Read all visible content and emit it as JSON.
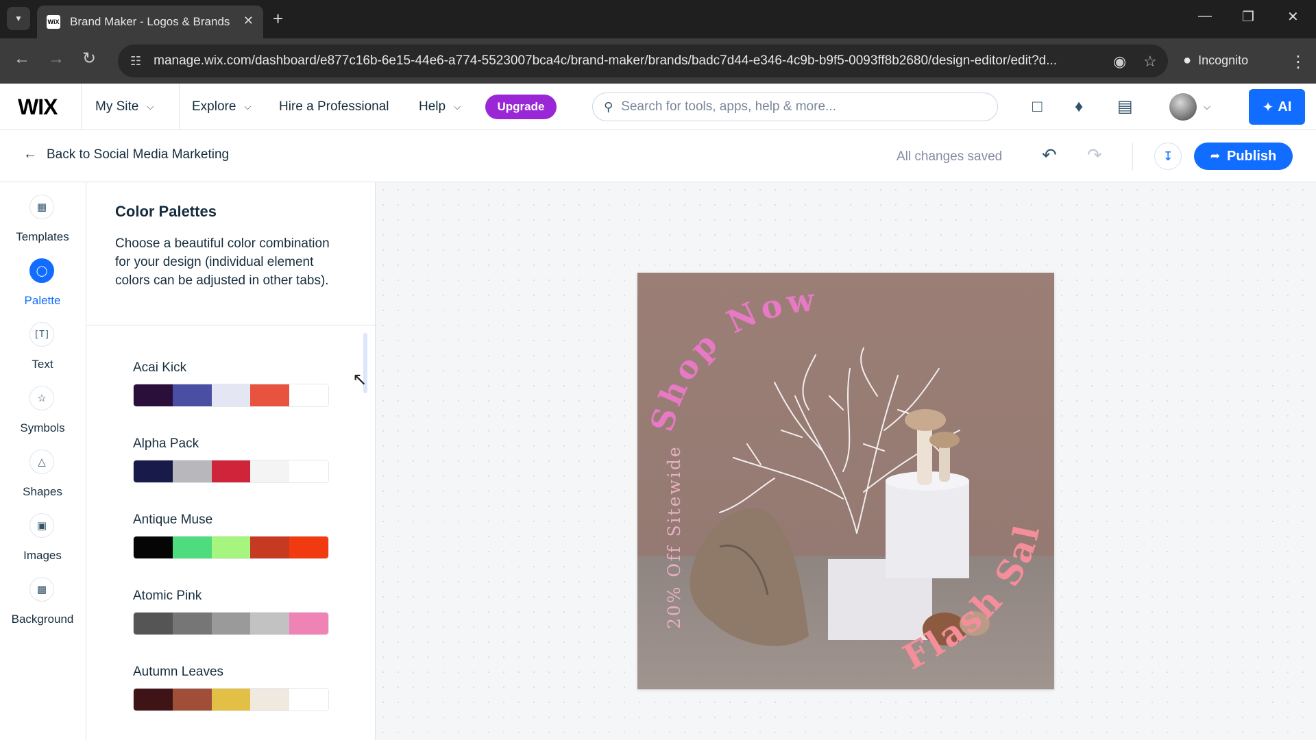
{
  "browser": {
    "tab_title": "Brand Maker - Logos & Brands",
    "favicon_text": "WiX",
    "url": "manage.wix.com/dashboard/e877c16b-6e15-44e6-a774-5523007bca4c/brand-maker/brands/badc7d44-e346-4c9b-b9f5-0093ff8b2680/design-editor/edit?d...",
    "incognito_label": "Incognito"
  },
  "wix_bar": {
    "logo": "WIX",
    "site_menu": "My Site",
    "nav": [
      "Explore",
      "Hire a Professional",
      "Help"
    ],
    "upgrade_label": "Upgrade",
    "search_placeholder": "Search for tools, apps, help & more...",
    "ai_label": "AI"
  },
  "editor_header": {
    "back_label": "Back to Social Media Marketing",
    "status": "All changes saved",
    "publish_label": "Publish"
  },
  "rail": {
    "items": [
      {
        "label": "Templates",
        "icon": "templates-icon"
      },
      {
        "label": "Palette",
        "icon": "palette-icon"
      },
      {
        "label": "Text",
        "icon": "text-icon"
      },
      {
        "label": "Symbols",
        "icon": "star-icon"
      },
      {
        "label": "Shapes",
        "icon": "shapes-icon"
      },
      {
        "label": "Images",
        "icon": "image-icon"
      },
      {
        "label": "Background",
        "icon": "background-icon"
      }
    ],
    "active": "Palette"
  },
  "panel": {
    "title": "Color Palettes",
    "description": "Choose a beautiful color combination for your design (individual element colors can be adjusted in other tabs).",
    "palettes": [
      {
        "name": "Acai Kick",
        "colors": [
          "#2a0f3a",
          "#4a4fa3",
          "#e4e6f4",
          "#e8533f",
          "#ffffff"
        ]
      },
      {
        "name": "Alpha Pack",
        "colors": [
          "#181a4a",
          "#b8b8bc",
          "#cf2439",
          "#f4f4f4",
          "#ffffff"
        ]
      },
      {
        "name": "Antique Muse",
        "colors": [
          "#050505",
          "#4fdc7e",
          "#a5f57f",
          "#c73a22",
          "#f23a10"
        ]
      },
      {
        "name": "Atomic Pink",
        "colors": [
          "#555555",
          "#767676",
          "#9a9a9a",
          "#c2c2c2",
          "#f083b5"
        ]
      },
      {
        "name": "Autumn Leaves",
        "colors": [
          "#3f1416",
          "#a14e38",
          "#e2c046",
          "#efe9df",
          "#ffffff"
        ]
      }
    ]
  },
  "design": {
    "text_top": "Shop Now",
    "text_side": "20% Off Sitewide",
    "text_bottom": "Flash Sale",
    "accent_pink": "#e879c4",
    "accent_salmon": "#f58e9b"
  }
}
